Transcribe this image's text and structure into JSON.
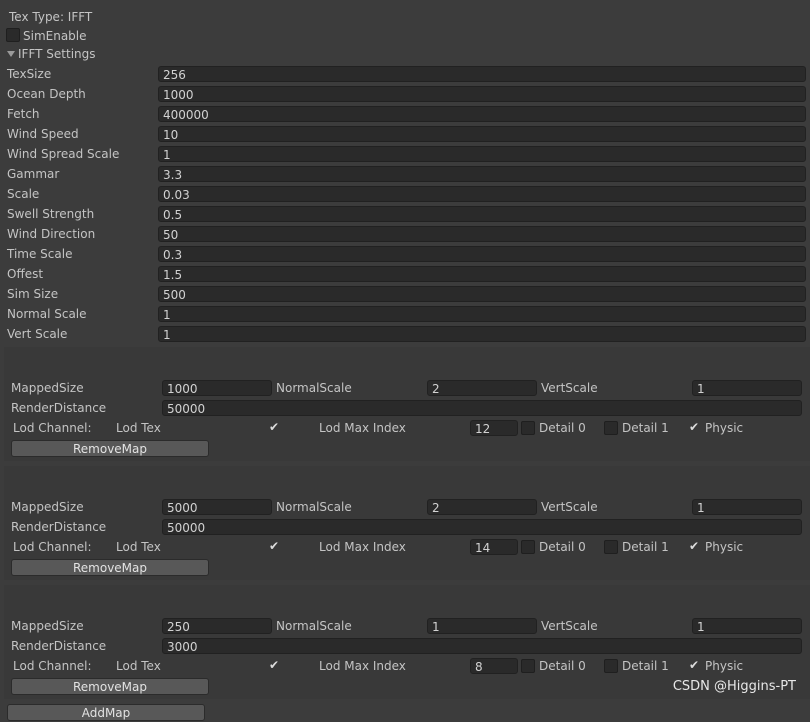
{
  "header": {
    "tex_type": "Tex Type: IFFT",
    "sim_enable": "SimEnable",
    "sim_enable_checked": false,
    "ifft_settings": "IFFT Settings"
  },
  "settings": [
    {
      "label": "TexSize",
      "value": "256"
    },
    {
      "label": "Ocean Depth",
      "value": "1000"
    },
    {
      "label": "Fetch",
      "value": "400000"
    },
    {
      "label": "Wind Speed",
      "value": "10"
    },
    {
      "label": "Wind Spread Scale",
      "value": "1"
    },
    {
      "label": "Gammar",
      "value": "3.3"
    },
    {
      "label": "Scale",
      "value": "0.03"
    },
    {
      "label": "Swell Strength",
      "value": "0.5"
    },
    {
      "label": "Wind Direction",
      "value": "50"
    },
    {
      "label": "Time Scale",
      "value": "0.3"
    },
    {
      "label": "Offest",
      "value": "1.5"
    },
    {
      "label": "Sim Size",
      "value": "500"
    },
    {
      "label": "Normal Scale",
      "value": "1"
    },
    {
      "label": "Vert Scale",
      "value": "1"
    }
  ],
  "map_labels": {
    "mapped_size": "MappedSize",
    "normal_scale": "NormalScale",
    "vert_scale": "VertScale",
    "render_distance": "RenderDistance",
    "lod_channel": "Lod Channel:",
    "lod_tex": "Lod Tex",
    "lod_max_index": "Lod Max Index",
    "detail0": "Detail 0",
    "detail1": "Detail 1",
    "physic": "Physic",
    "remove_map": "RemoveMap"
  },
  "maps": [
    {
      "mapped_size": "1000",
      "normal_scale": "2",
      "vert_scale": "1",
      "render_distance": "50000",
      "lod_tex": true,
      "lod_max_index": "12",
      "detail0": false,
      "detail1": false,
      "physic": true
    },
    {
      "mapped_size": "5000",
      "normal_scale": "2",
      "vert_scale": "1",
      "render_distance": "50000",
      "lod_tex": true,
      "lod_max_index": "14",
      "detail0": false,
      "detail1": false,
      "physic": true
    },
    {
      "mapped_size": "250",
      "normal_scale": "1",
      "vert_scale": "1",
      "render_distance": "3000",
      "lod_tex": true,
      "lod_max_index": "8",
      "detail0": false,
      "detail1": false,
      "physic": true
    }
  ],
  "add_map": "AddMap",
  "watermark": "CSDN @Higgins-PT",
  "icons": {
    "check": "check-icon",
    "foldout": "triangle-down-icon"
  },
  "colors": {
    "background": "#3c3c3c",
    "field": "#2a2a2a",
    "panel": "#393939",
    "button": "#585858",
    "text": "#c4c4c4"
  }
}
